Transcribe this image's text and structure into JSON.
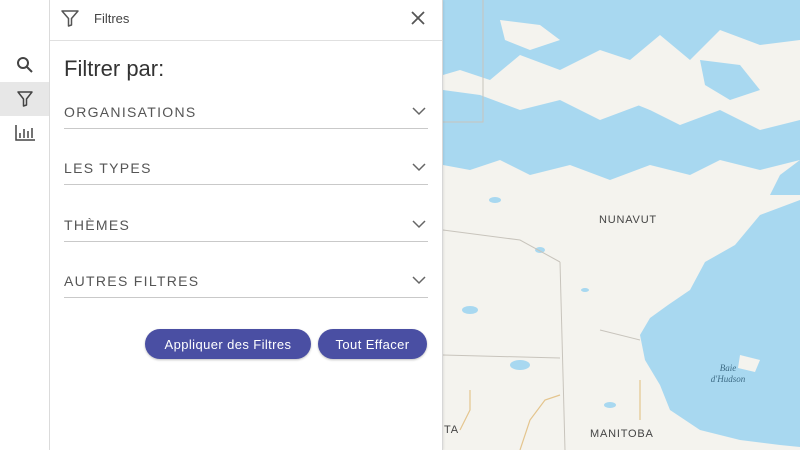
{
  "colors": {
    "water": "#a8d8f0",
    "land": "#f4f3ee",
    "accent": "#4a4fa3"
  },
  "rail": {
    "items": [
      {
        "icon": "search-icon"
      },
      {
        "icon": "filter-icon",
        "active": true
      },
      {
        "icon": "bar-chart-icon"
      }
    ]
  },
  "panel": {
    "header_title": "Filtres",
    "heading": "Filtrer par:",
    "sections": [
      {
        "label": "ORGANISATIONS"
      },
      {
        "label": "LES TYPES"
      },
      {
        "label": "THÈMES"
      },
      {
        "label": "AUTRES FILTRES"
      }
    ],
    "apply_label": "Appliquer des Filtres",
    "clear_label": "Tout Effacer"
  },
  "map": {
    "label_nunavut": "NUNAVUT",
    "label_baie_line1": "Baie",
    "label_baie_line2": "d'Hudson",
    "label_manitoba": "MANITOBA",
    "label_ta": "TA"
  }
}
